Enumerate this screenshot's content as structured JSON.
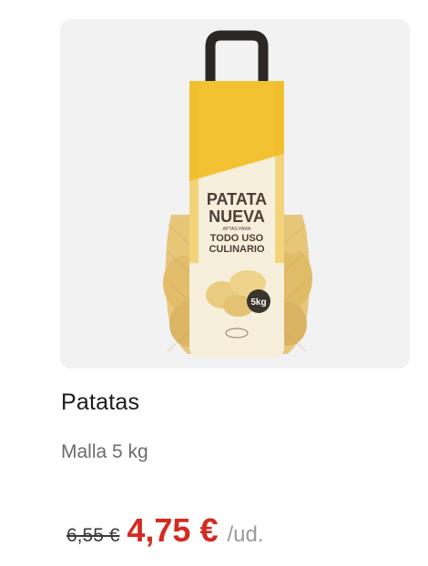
{
  "product": {
    "name": "Patatas",
    "description": "Malla 5 kg",
    "old_price": "6,55 €",
    "price": "4,75 €",
    "unit": "/ud."
  },
  "packaging": {
    "line1": "PATATA",
    "line2": "NUEVA",
    "small": "APTAS PARA",
    "line3": "TODO USO",
    "line4": "CULINARIO",
    "weight": "5kg"
  },
  "colors": {
    "price": "#d42a1f",
    "bag_yellow": "#f2c232",
    "bag_cream": "#f6efdc",
    "potato": "#e8c67a"
  }
}
